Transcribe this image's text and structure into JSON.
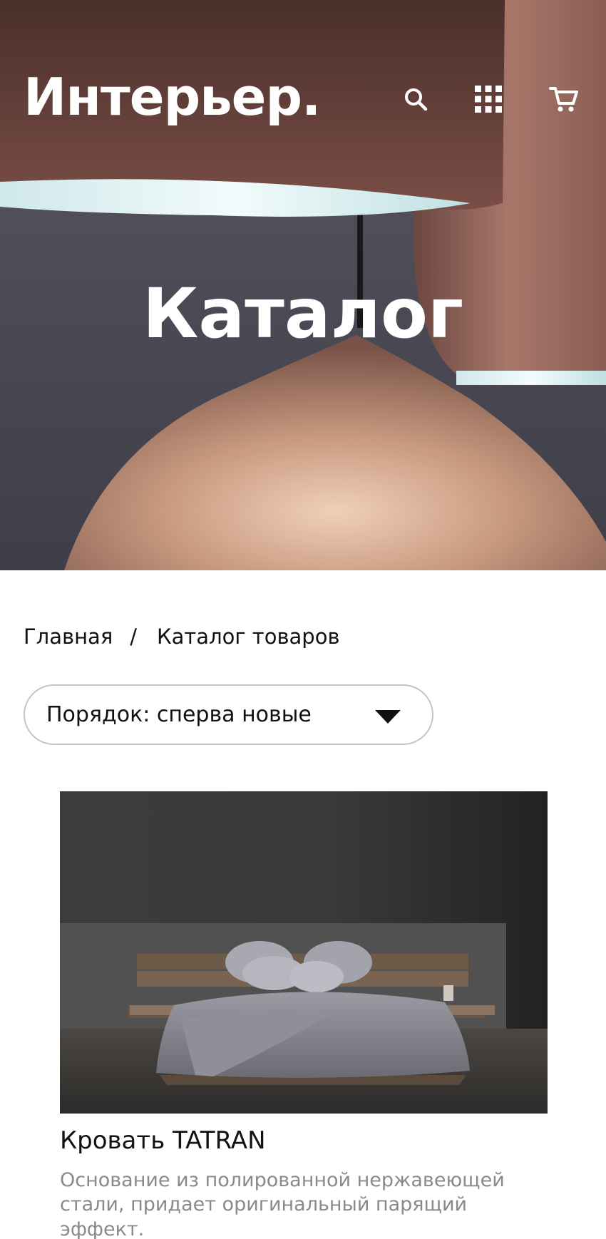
{
  "header": {
    "logo": "Интерьер.",
    "icons": [
      "search-icon",
      "grid-menu-icon",
      "cart-icon"
    ]
  },
  "hero": {
    "title": "Каталог"
  },
  "breadcrumb": {
    "home": "Главная",
    "separator": "/",
    "current": "Каталог товаров"
  },
  "sort": {
    "label": "Порядок: сперва новые"
  },
  "products": [
    {
      "name": "Кровать TATRAN",
      "description": "Основание из полированной нержавеющей стали, придает оригинальный парящий эффект."
    }
  ],
  "colors": {
    "text": "#111111",
    "muted": "#8a8a8a",
    "border": "#c4c4c4",
    "hero_text": "#ffffff"
  }
}
